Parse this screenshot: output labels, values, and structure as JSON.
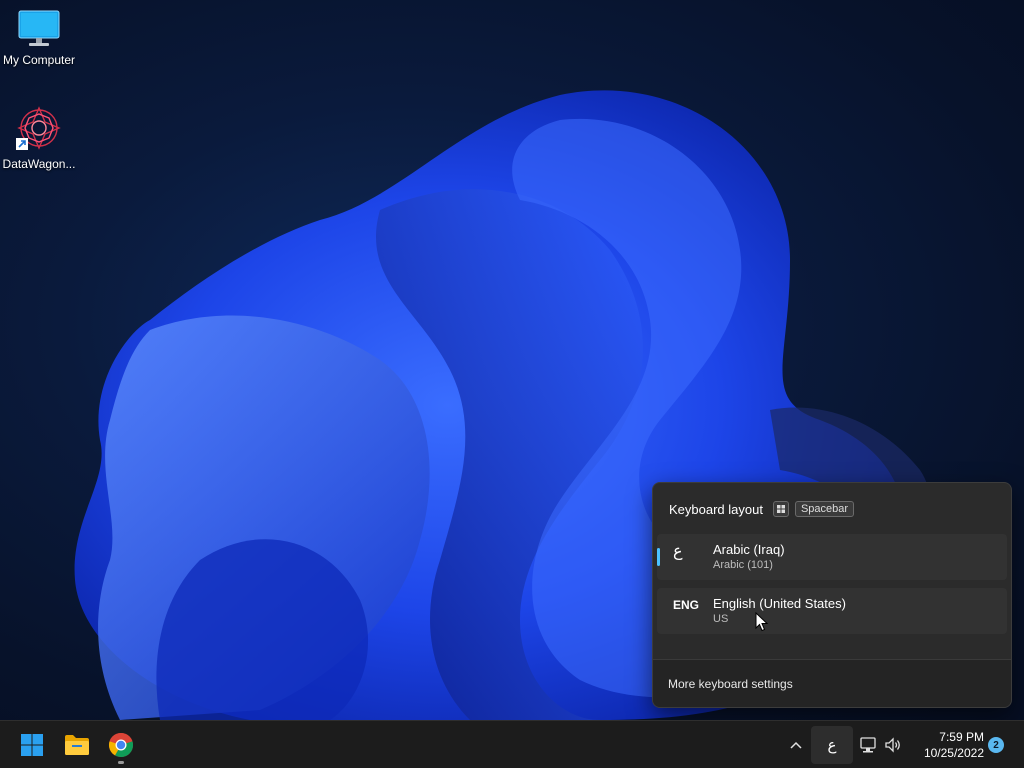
{
  "desktop": {
    "icons": [
      {
        "label": "My Computer",
        "icon": "monitor-icon"
      },
      {
        "label": "DataWagon...",
        "icon": "datawagon-app-icon",
        "shortcut": true
      }
    ]
  },
  "keyboard_flyout": {
    "title": "Keyboard layout",
    "shortcut_key": "Spacebar",
    "layouts": [
      {
        "code": "ع",
        "name": "Arabic (Iraq)",
        "keyboard": "Arabic (101)",
        "selected": true
      },
      {
        "code": "ENG",
        "name": "English (United States)",
        "keyboard": "US",
        "selected": false
      }
    ],
    "settings_link": "More keyboard settings"
  },
  "taskbar": {
    "apps": [
      {
        "name": "start-button",
        "icon": "windows-logo-icon"
      },
      {
        "name": "file-explorer",
        "icon": "folder-icon"
      },
      {
        "name": "chrome",
        "icon": "chrome-icon",
        "running": true
      }
    ],
    "tray": {
      "ime_indicator": "ع",
      "time": "7:59 PM",
      "date": "10/25/2022",
      "notification_count": "2"
    }
  },
  "colors": {
    "accent": "#4cc2ff",
    "flyout_bg": "#2b2b2b",
    "taskbar_bg": "#1c1c1c"
  }
}
